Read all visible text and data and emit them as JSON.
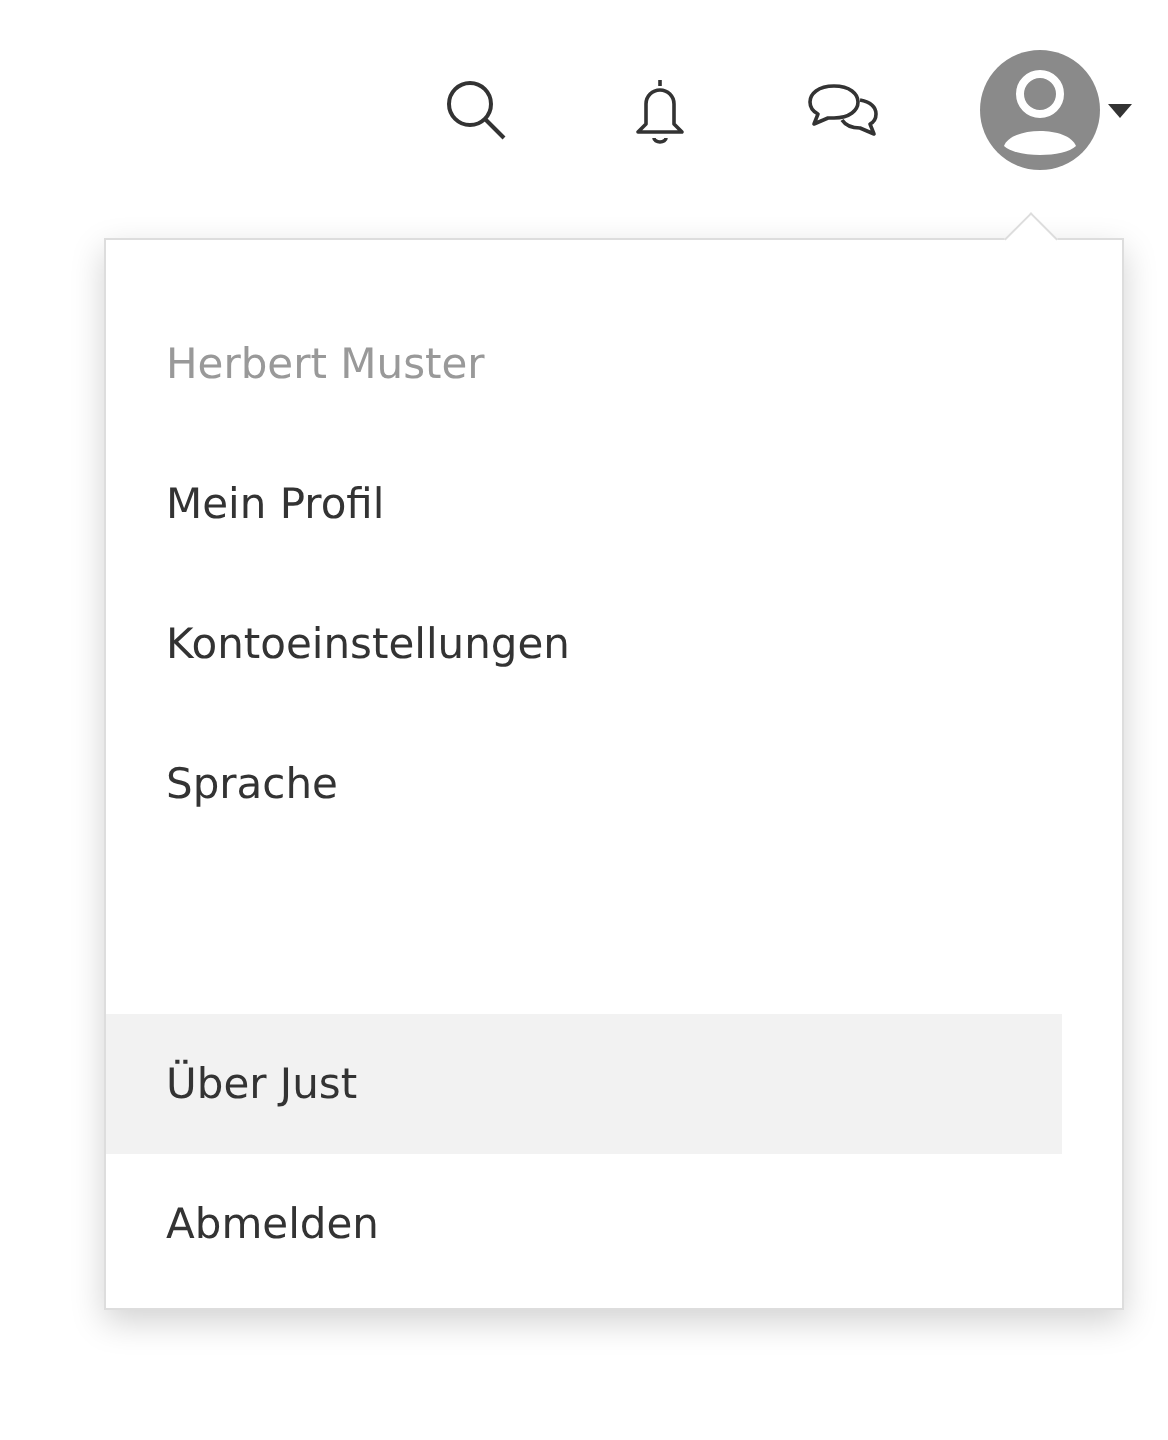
{
  "user_menu": {
    "user_name": "Herbert Muster",
    "main_items": [
      {
        "label": "Mein Profil",
        "highlighted": false
      },
      {
        "label": "Kontoeinstellungen",
        "highlighted": false
      },
      {
        "label": "Sprache",
        "highlighted": false
      }
    ],
    "footer_items": [
      {
        "label": "Über Just",
        "highlighted": true
      },
      {
        "label": "Abmelden",
        "highlighted": false
      }
    ]
  }
}
